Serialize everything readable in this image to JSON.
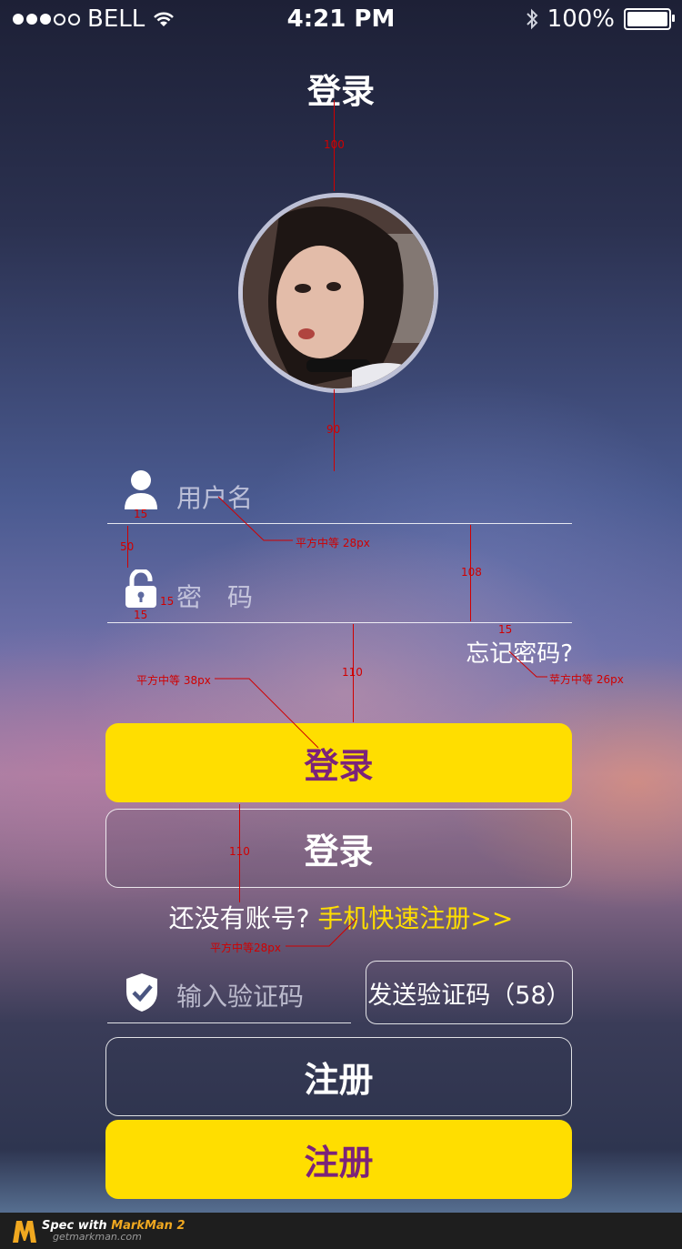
{
  "status_bar": {
    "carrier": "BELL",
    "time": "4:21 PM",
    "battery": "100%"
  },
  "header": {
    "title": "登录"
  },
  "form": {
    "username_placeholder": "用户名",
    "password_placeholder": "密　码",
    "forgot_password": "忘记密码?",
    "verify_placeholder": "输入验证码",
    "send_code_label": "发送验证码（58）"
  },
  "buttons": {
    "login_primary": "登录",
    "login_secondary": "登录",
    "register_outline": "注册",
    "register_primary": "注册"
  },
  "register_prompt": {
    "text": "还没有账号?",
    "link": "手机快速注册>>"
  },
  "annotations": {
    "title_gap": "100",
    "avatar_gap": "90",
    "icon_gap_user": "15",
    "field_gap": "50",
    "field_height": "108",
    "icon_gap_lock_h": "15",
    "icon_gap_lock_v": "15",
    "forgot_gap": "15",
    "button_gap": "110",
    "button_gap_2": "110",
    "font_username": "平方中等 28px",
    "font_forgot": "苹方中等 26px",
    "font_login": "平方中等 38px",
    "font_register": "平方中等28px"
  },
  "footer": {
    "brand_prefix": "Spec with ",
    "brand": "MarkMan 2",
    "url": "getmarkman.com"
  },
  "colors": {
    "accent_yellow": "#ffde00",
    "button_text_purple": "#7b237a",
    "annotation_red": "#d00000"
  }
}
